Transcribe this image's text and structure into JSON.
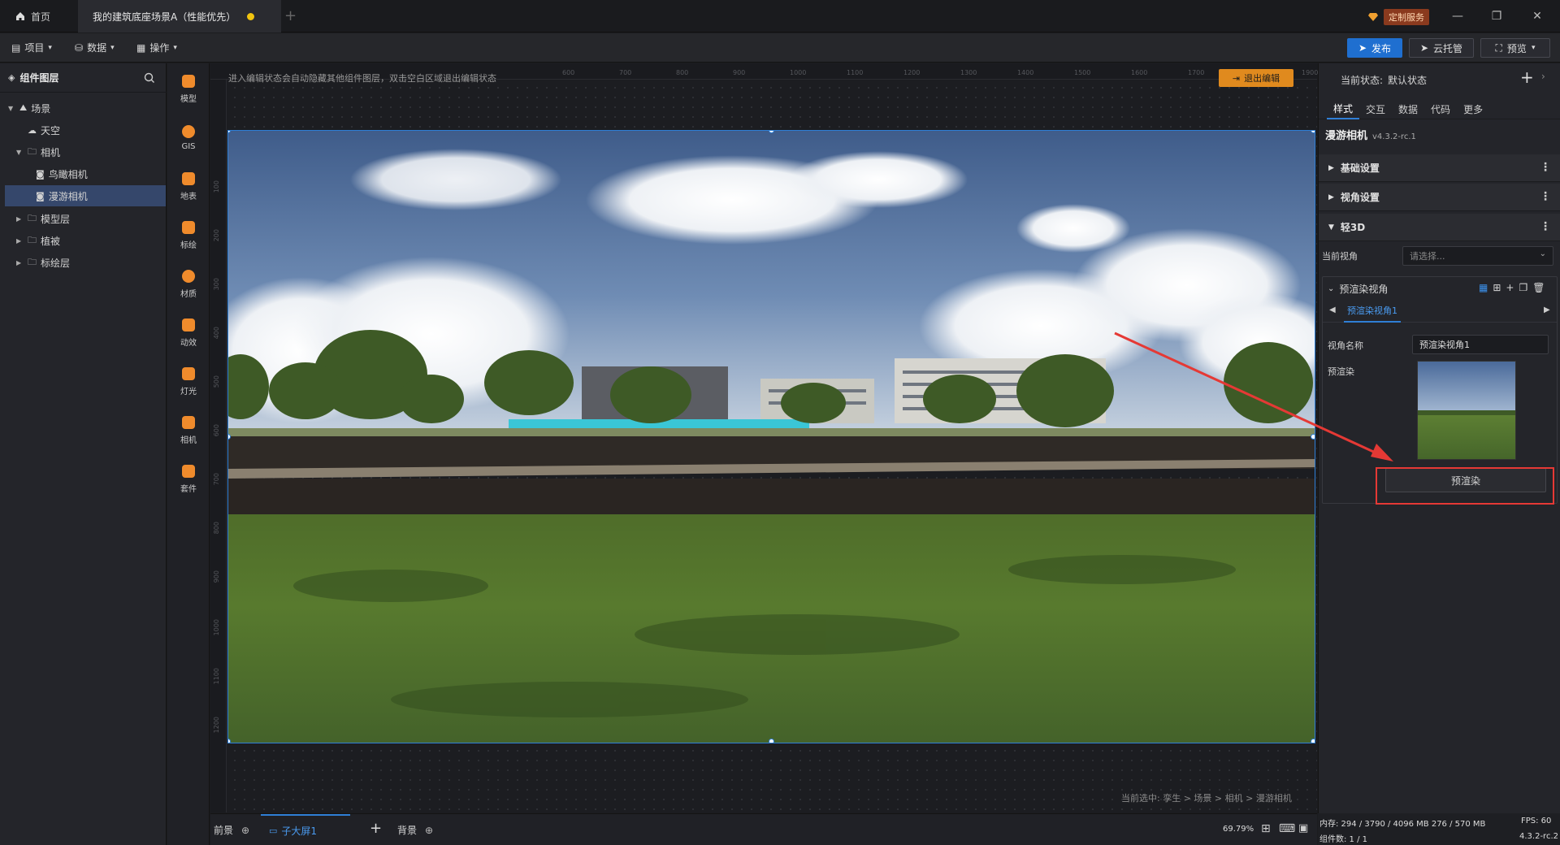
{
  "titlebar": {
    "home_tab": "首页",
    "project_tab": "我的建筑底座场景A（性能优先）",
    "custom_service": "定制服务"
  },
  "menubar": {
    "project": "项目",
    "data": "数据",
    "operate": "操作",
    "publish": "发布",
    "cloud": "云托管",
    "preview": "预览"
  },
  "layers": {
    "title": "组件图层",
    "items": [
      {
        "label": "场景",
        "indent": 0
      },
      {
        "label": "天空",
        "indent": 1
      },
      {
        "label": "相机",
        "indent": 1
      },
      {
        "label": "鸟瞰相机",
        "indent": 2
      },
      {
        "label": "漫游相机",
        "indent": 2,
        "selected": true
      },
      {
        "label": "模型层",
        "indent": 1
      },
      {
        "label": "植被",
        "indent": 1
      },
      {
        "label": "标绘层",
        "indent": 1
      }
    ]
  },
  "tools": [
    "模型",
    "GIS",
    "地表",
    "标绘",
    "材质",
    "动效",
    "灯光",
    "相机",
    "套件"
  ],
  "canvas": {
    "hint": "进入编辑状态会自动隐藏其他组件图层，双击空白区域退出编辑状态",
    "exit_edit": "退出编辑",
    "breadcrumb": "当前选中: 孪生 > 场景 > 相机 > 漫游相机",
    "ruler_h": [
      "600",
      "700",
      "800",
      "900",
      "1000",
      "1100",
      "1200",
      "1300",
      "1400",
      "1500",
      "1600",
      "1700",
      "1800",
      "1900"
    ],
    "ruler_v": [
      "100",
      "200",
      "300",
      "400",
      "500",
      "600",
      "700",
      "800",
      "900",
      "1000",
      "1100",
      "1200"
    ]
  },
  "bottombar": {
    "foreground": "前景",
    "sub_screen": "子大屏1",
    "background": "背景",
    "zoom": "69.79%"
  },
  "right": {
    "state_label": "当前状态:",
    "state_value": "默认状态",
    "tabs": [
      "样式",
      "交互",
      "数据",
      "代码",
      "更多"
    ],
    "active_tab": "样式",
    "component_name": "漫游相机",
    "version": "v4.3.2-rc.1",
    "sections": {
      "basic": "基础设置",
      "view": "视角设置",
      "light3d": "轻3D"
    },
    "current_view_label": "当前视角",
    "current_view_placeholder": "请选择...",
    "prerender_group": "预渲染视角",
    "prerender_item": "预渲染视角1",
    "view_name_label": "视角名称",
    "view_name_value": "预渲染视角1",
    "prerender_label": "预渲染",
    "prerender_button": "预渲染"
  },
  "status": {
    "memory": "内存: 294 / 3790 / 4096 MB  276 / 570 MB",
    "fps": "FPS: 60",
    "components": "组件数: 1 / 1",
    "version": "4.3.2-rc.2"
  },
  "colors": {
    "accent": "#2f7fd6",
    "orange": "#ef8b2c",
    "annotation_red": "#e53935",
    "selected_row": "#35476b"
  }
}
